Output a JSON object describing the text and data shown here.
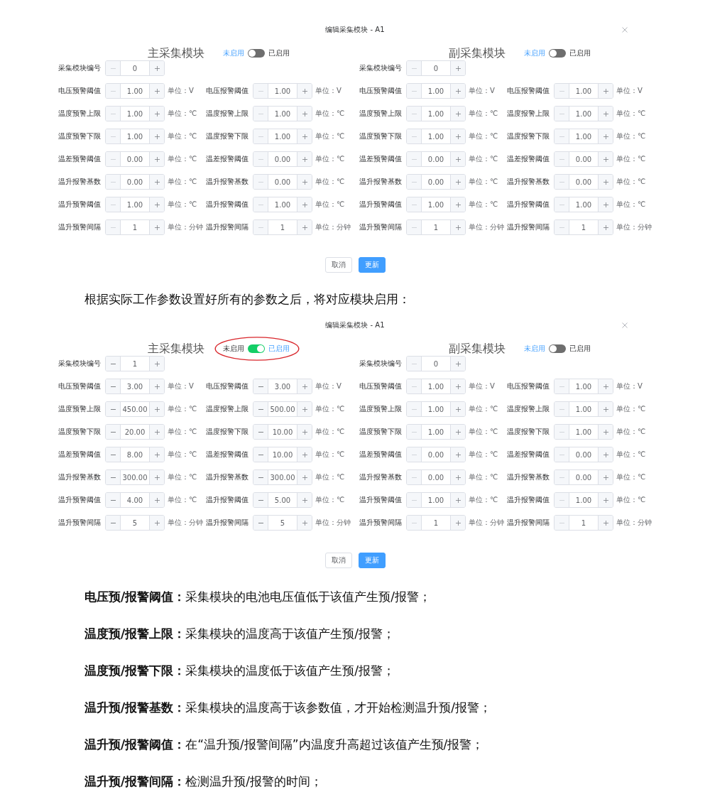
{
  "blocks": [
    {
      "kind": "dialog",
      "title": "编辑采集模块 - A1",
      "modules": [
        {
          "title": "主采集模块",
          "off_label": "未启用",
          "on_label": "已启用",
          "enabled": false,
          "circled": false,
          "decrement_disabled": true,
          "id_field": {
            "label": "采集模块编号",
            "value": "0"
          },
          "rows": [
            [
              {
                "label": "电压预警阈值",
                "value": "1.00",
                "unit": "单位：V"
              },
              {
                "label": "电压报警阈值",
                "value": "1.00",
                "unit": "单位：V"
              }
            ],
            [
              {
                "label": "温度预警上限",
                "value": "1.00",
                "unit": "单位：℃"
              },
              {
                "label": "温度报警上限",
                "value": "1.00",
                "unit": "单位：℃"
              }
            ],
            [
              {
                "label": "温度预警下限",
                "value": "1.00",
                "unit": "单位：℃"
              },
              {
                "label": "温度报警下限",
                "value": "1.00",
                "unit": "单位：℃"
              }
            ],
            [
              {
                "label": "温差预警阈值",
                "value": "0.00",
                "unit": "单位：℃"
              },
              {
                "label": "温差报警阈值",
                "value": "0.00",
                "unit": "单位：℃"
              }
            ],
            [
              {
                "label": "温升报警基数",
                "value": "0.00",
                "unit": "单位：℃"
              },
              {
                "label": "温升报警基数",
                "value": "0.00",
                "unit": "单位：℃"
              }
            ],
            [
              {
                "label": "温升预警阈值",
                "value": "1.00",
                "unit": "单位：℃"
              },
              {
                "label": "温升报警阈值",
                "value": "1.00",
                "unit": "单位：℃"
              }
            ],
            [
              {
                "label": "温升预警间隔",
                "value": "1",
                "unit": "单位：分钟"
              },
              {
                "label": "温升报警间隔",
                "value": "1",
                "unit": "单位：分钟"
              }
            ]
          ]
        },
        {
          "title": "副采集模块",
          "off_label": "未启用",
          "on_label": "已启用",
          "enabled": false,
          "circled": false,
          "decrement_disabled": true,
          "id_field": {
            "label": "采集模块编号",
            "value": "0"
          },
          "rows": [
            [
              {
                "label": "电压预警阈值",
                "value": "1.00",
                "unit": "单位：V"
              },
              {
                "label": "电压报警阈值",
                "value": "1.00",
                "unit": "单位：V"
              }
            ],
            [
              {
                "label": "温度预警上限",
                "value": "1.00",
                "unit": "单位：℃"
              },
              {
                "label": "温度报警上限",
                "value": "1.00",
                "unit": "单位：℃"
              }
            ],
            [
              {
                "label": "温度预警下限",
                "value": "1.00",
                "unit": "单位：℃"
              },
              {
                "label": "温度报警下限",
                "value": "1.00",
                "unit": "单位：℃"
              }
            ],
            [
              {
                "label": "温差预警阈值",
                "value": "0.00",
                "unit": "单位：℃"
              },
              {
                "label": "温差报警阈值",
                "value": "0.00",
                "unit": "单位：℃"
              }
            ],
            [
              {
                "label": "温升报警基数",
                "value": "0.00",
                "unit": "单位：℃"
              },
              {
                "label": "温升报警基数",
                "value": "0.00",
                "unit": "单位：℃"
              }
            ],
            [
              {
                "label": "温升预警阈值",
                "value": "1.00",
                "unit": "单位：℃"
              },
              {
                "label": "温升报警阈值",
                "value": "1.00",
                "unit": "单位：℃"
              }
            ],
            [
              {
                "label": "温升预警间隔",
                "value": "1",
                "unit": "单位：分钟"
              },
              {
                "label": "温升报警间隔",
                "value": "1",
                "unit": "单位：分钟"
              }
            ]
          ]
        }
      ],
      "buttons": [
        {
          "label": "取消",
          "kind": "default"
        },
        {
          "label": "更新",
          "kind": "primary"
        }
      ]
    },
    {
      "kind": "paragraph",
      "text": "根据实际工作参数设置好所有的参数之后，将对应模块启用："
    },
    {
      "kind": "dialog",
      "title": "编辑采集模块 - A1",
      "modules": [
        {
          "title": "主采集模块",
          "off_label": "未启用",
          "on_label": "已启用",
          "enabled": true,
          "circled": true,
          "decrement_disabled": false,
          "id_field": {
            "label": "采集模块编号",
            "value": "1"
          },
          "rows": [
            [
              {
                "label": "电压预警阈值",
                "value": "3.00",
                "unit": "单位：V"
              },
              {
                "label": "电压报警阈值",
                "value": "3.00",
                "unit": "单位：V"
              }
            ],
            [
              {
                "label": "温度预警上限",
                "value": "450.00",
                "unit": "单位：℃"
              },
              {
                "label": "温度报警上限",
                "value": "500.00",
                "unit": "单位：℃"
              }
            ],
            [
              {
                "label": "温度预警下限",
                "value": "20.00",
                "unit": "单位：℃"
              },
              {
                "label": "温度报警下限",
                "value": "10.00",
                "unit": "单位：℃"
              }
            ],
            [
              {
                "label": "温差预警阈值",
                "value": "8.00",
                "unit": "单位：℃"
              },
              {
                "label": "温差报警阈值",
                "value": "10.00",
                "unit": "单位：℃"
              }
            ],
            [
              {
                "label": "温升报警基数",
                "value": "300.00",
                "unit": "单位：℃"
              },
              {
                "label": "温升报警基数",
                "value": "300.00",
                "unit": "单位：℃"
              }
            ],
            [
              {
                "label": "温升预警阈值",
                "value": "4.00",
                "unit": "单位：℃"
              },
              {
                "label": "温升报警阈值",
                "value": "5.00",
                "unit": "单位：℃"
              }
            ],
            [
              {
                "label": "温升预警间隔",
                "value": "5",
                "unit": "单位：分钟"
              },
              {
                "label": "温升报警间隔",
                "value": "5",
                "unit": "单位：分钟"
              }
            ]
          ]
        },
        {
          "title": "副采集模块",
          "off_label": "未启用",
          "on_label": "已启用",
          "enabled": false,
          "circled": false,
          "decrement_disabled": true,
          "id_field": {
            "label": "采集模块编号",
            "value": "0"
          },
          "rows": [
            [
              {
                "label": "电压预警阈值",
                "value": "1.00",
                "unit": "单位：V"
              },
              {
                "label": "电压报警阈值",
                "value": "1.00",
                "unit": "单位：V"
              }
            ],
            [
              {
                "label": "温度预警上限",
                "value": "1.00",
                "unit": "单位：℃"
              },
              {
                "label": "温度报警上限",
                "value": "1.00",
                "unit": "单位：℃"
              }
            ],
            [
              {
                "label": "温度预警下限",
                "value": "1.00",
                "unit": "单位：℃"
              },
              {
                "label": "温度报警下限",
                "value": "1.00",
                "unit": "单位：℃"
              }
            ],
            [
              {
                "label": "温差预警阈值",
                "value": "0.00",
                "unit": "单位：℃"
              },
              {
                "label": "温差报警阈值",
                "value": "0.00",
                "unit": "单位：℃"
              }
            ],
            [
              {
                "label": "温升报警基数",
                "value": "0.00",
                "unit": "单位：℃"
              },
              {
                "label": "温升报警基数",
                "value": "0.00",
                "unit": "单位：℃"
              }
            ],
            [
              {
                "label": "温升预警阈值",
                "value": "1.00",
                "unit": "单位：℃"
              },
              {
                "label": "温升报警阈值",
                "value": "1.00",
                "unit": "单位：℃"
              }
            ],
            [
              {
                "label": "温升预警间隔",
                "value": "1",
                "unit": "单位：分钟"
              },
              {
                "label": "温升报警间隔",
                "value": "1",
                "unit": "单位：分钟"
              }
            ]
          ]
        }
      ],
      "buttons": [
        {
          "label": "取消",
          "kind": "default"
        },
        {
          "label": "更新",
          "kind": "primary"
        }
      ]
    },
    {
      "kind": "definitions",
      "items": [
        "**电压预/报警阈值：**采集模块的电池电压值低于该值产生预/报警；",
        "**温度预/报警上限：**采集模块的温度高于该值产生预/报警；",
        "**温度预/报警下限：**采集模块的温度低于该值产生预/报警；",
        "**温升预/报警基数：**采集模块的温度高于该参数值，才开始检测温升预/报警；",
        "**温升预/报警阈值：**在“温升预/报警间隔”内温度升高超过该值产生预/报警；",
        "**温升预/报警间隔：**检测温升预/报警的时间；"
      ]
    }
  ]
}
